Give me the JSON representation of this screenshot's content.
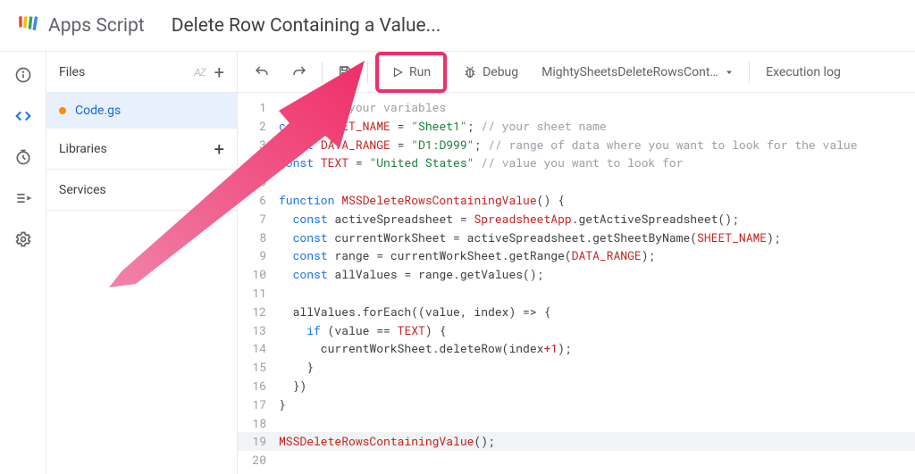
{
  "header": {
    "app_name": "Apps Script",
    "project_title": "Delete Row Containing a Value..."
  },
  "files_pane": {
    "header_label": "Files",
    "file_name": "Code.gs",
    "libraries_label": "Libraries",
    "services_label": "Services"
  },
  "toolbar": {
    "run_label": "Run",
    "debug_label": "Debug",
    "function_name": "MightySheetsDeleteRowsConta...",
    "exec_log_label": "Execution log"
  },
  "code": {
    "lines": [
      {
        "n": "1",
        "segs": [
          {
            "t": "",
            "c": ""
          },
          {
            "t": "   Define your variables",
            "c": "tok-comment"
          }
        ]
      },
      {
        "n": "2",
        "segs": [
          {
            "t": "const ",
            "c": "tok-kw"
          },
          {
            "t": "SHEET_NAME",
            "c": "tok-name"
          },
          {
            "t": " = ",
            "c": ""
          },
          {
            "t": "\"Sheet1\"",
            "c": "tok-str"
          },
          {
            "t": "; ",
            "c": ""
          },
          {
            "t": "// your sheet name",
            "c": "tok-comment"
          }
        ]
      },
      {
        "n": "3",
        "segs": [
          {
            "t": "const ",
            "c": "tok-kw"
          },
          {
            "t": "DATA_RANGE",
            "c": "tok-name"
          },
          {
            "t": " = ",
            "c": ""
          },
          {
            "t": "\"D1:D999\"",
            "c": "tok-str"
          },
          {
            "t": "; ",
            "c": ""
          },
          {
            "t": "// range of data where you want to look for the value",
            "c": "tok-comment"
          }
        ]
      },
      {
        "n": "4",
        "segs": [
          {
            "t": "const ",
            "c": "tok-kw"
          },
          {
            "t": "TEXT",
            "c": "tok-name"
          },
          {
            "t": " = ",
            "c": ""
          },
          {
            "t": "\"United States\"",
            "c": "tok-str"
          },
          {
            "t": " ",
            "c": ""
          },
          {
            "t": "// value you want to look for",
            "c": "tok-comment"
          }
        ]
      },
      {
        "n": "5",
        "segs": [
          {
            "t": "",
            "c": ""
          }
        ]
      },
      {
        "n": "6",
        "segs": [
          {
            "t": "function ",
            "c": "tok-kw"
          },
          {
            "t": "MSSDeleteRowsContainingValue",
            "c": "tok-func"
          },
          {
            "t": "() {",
            "c": ""
          }
        ]
      },
      {
        "n": "7",
        "segs": [
          {
            "t": "  ",
            "c": ""
          },
          {
            "t": "const ",
            "c": "tok-kw"
          },
          {
            "t": "activeSpreadsheet = ",
            "c": ""
          },
          {
            "t": "SpreadsheetApp",
            "c": "tok-name"
          },
          {
            "t": ".getActiveSpreadsheet();",
            "c": ""
          }
        ]
      },
      {
        "n": "8",
        "segs": [
          {
            "t": "  ",
            "c": ""
          },
          {
            "t": "const ",
            "c": "tok-kw"
          },
          {
            "t": "currentWorkSheet = activeSpreadsheet.getSheetByName(",
            "c": ""
          },
          {
            "t": "SHEET_NAME",
            "c": "tok-name"
          },
          {
            "t": ");",
            "c": ""
          }
        ]
      },
      {
        "n": "9",
        "segs": [
          {
            "t": "  ",
            "c": ""
          },
          {
            "t": "const ",
            "c": "tok-kw"
          },
          {
            "t": "range = currentWorkSheet.getRange(",
            "c": ""
          },
          {
            "t": "DATA_RANGE",
            "c": "tok-name"
          },
          {
            "t": ");",
            "c": ""
          }
        ]
      },
      {
        "n": "10",
        "segs": [
          {
            "t": "  ",
            "c": ""
          },
          {
            "t": "const ",
            "c": "tok-kw"
          },
          {
            "t": "allValues = range.getValues();",
            "c": ""
          }
        ]
      },
      {
        "n": "11",
        "segs": [
          {
            "t": "",
            "c": ""
          }
        ]
      },
      {
        "n": "12",
        "segs": [
          {
            "t": "  allValues.forEach((value, index) => {",
            "c": ""
          }
        ]
      },
      {
        "n": "13",
        "segs": [
          {
            "t": "    ",
            "c": ""
          },
          {
            "t": "if ",
            "c": "tok-kw"
          },
          {
            "t": "(value == ",
            "c": ""
          },
          {
            "t": "TEXT",
            "c": "tok-name"
          },
          {
            "t": ") {",
            "c": ""
          }
        ]
      },
      {
        "n": "14",
        "segs": [
          {
            "t": "      currentWorkSheet.deleteRow(index",
            "c": ""
          },
          {
            "t": "+1",
            "c": "tok-name"
          },
          {
            "t": ");",
            "c": ""
          }
        ]
      },
      {
        "n": "15",
        "segs": [
          {
            "t": "    }",
            "c": ""
          }
        ]
      },
      {
        "n": "16",
        "segs": [
          {
            "t": "  })",
            "c": ""
          }
        ]
      },
      {
        "n": "17",
        "segs": [
          {
            "t": "}",
            "c": ""
          }
        ]
      },
      {
        "n": "18",
        "segs": [
          {
            "t": "",
            "c": ""
          }
        ]
      },
      {
        "n": "19",
        "active": true,
        "segs": [
          {
            "t": "MSSDeleteRowsContainingValue",
            "c": "tok-func"
          },
          {
            "t": "();",
            "c": ""
          }
        ]
      },
      {
        "n": "20",
        "segs": [
          {
            "t": "",
            "c": ""
          }
        ]
      }
    ]
  }
}
